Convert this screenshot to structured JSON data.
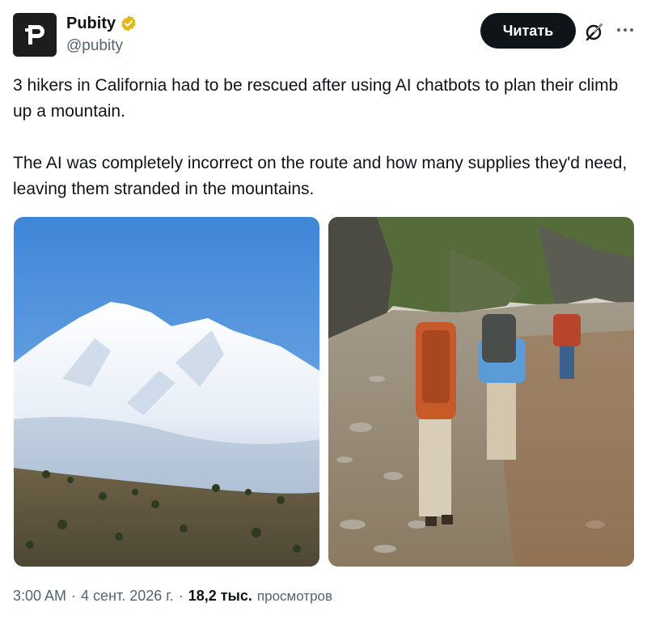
{
  "author": {
    "display_name": "Pubity",
    "handle": "@pubity",
    "avatar_icon": "pubity-logo-icon",
    "verified_icon": "verified-badge-icon",
    "verified_color": "#e2b719"
  },
  "actions": {
    "read_label": "Читать",
    "grok_icon": "grok-icon",
    "more_icon": "more-icon"
  },
  "tweet": {
    "text": "3 hikers in California had to be rescued after using AI chatbots to plan their climb up a mountain.\n\nThe AI was completely incorrect on the route and how many supplies they'd need, leaving them stranded in the mountains."
  },
  "media": [
    {
      "icon": "snowy-mountain-photo"
    },
    {
      "icon": "hikers-on-rocky-shore-photo"
    }
  ],
  "meta": {
    "time": "3:00 AM",
    "date": "4 сент. 2026 г.",
    "views_count": "18,2 тыс.",
    "views_label": "просмотров",
    "separator": "·"
  },
  "colors": {
    "text": "#0f1419",
    "secondary": "#536471",
    "button_bg": "#0f1419"
  }
}
